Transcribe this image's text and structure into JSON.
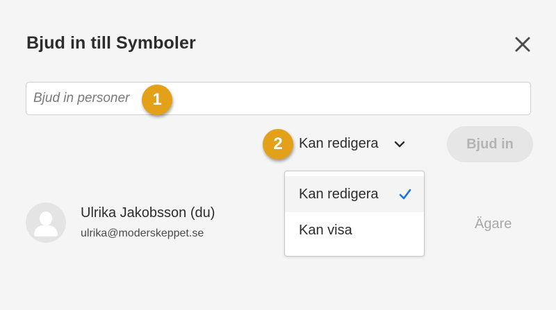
{
  "dialog": {
    "title": "Bjud in till Symboler",
    "close_icon": "close-icon"
  },
  "invite": {
    "placeholder": "Bjud in personer",
    "value": "",
    "button_label": "Bjud in"
  },
  "annotations": [
    {
      "number": "1"
    },
    {
      "number": "2"
    }
  ],
  "permission": {
    "selected": "Kan redigera",
    "chevron_icon": "chevron-down-icon",
    "options": [
      {
        "label": "Kan redigera",
        "selected": true
      },
      {
        "label": "Kan visa",
        "selected": false
      }
    ]
  },
  "members": [
    {
      "name": "Ulrika Jakobsson (du)",
      "email": "ulrika@moderskeppet.se",
      "role": "Ägare",
      "avatar_icon": "user-avatar-icon"
    }
  ],
  "colors": {
    "background": "#f5f5f5",
    "badge": "#e2a118",
    "check": "#1473e6",
    "disabled_button": "#e6e6e6",
    "disabled_text": "#b4b4b4"
  }
}
